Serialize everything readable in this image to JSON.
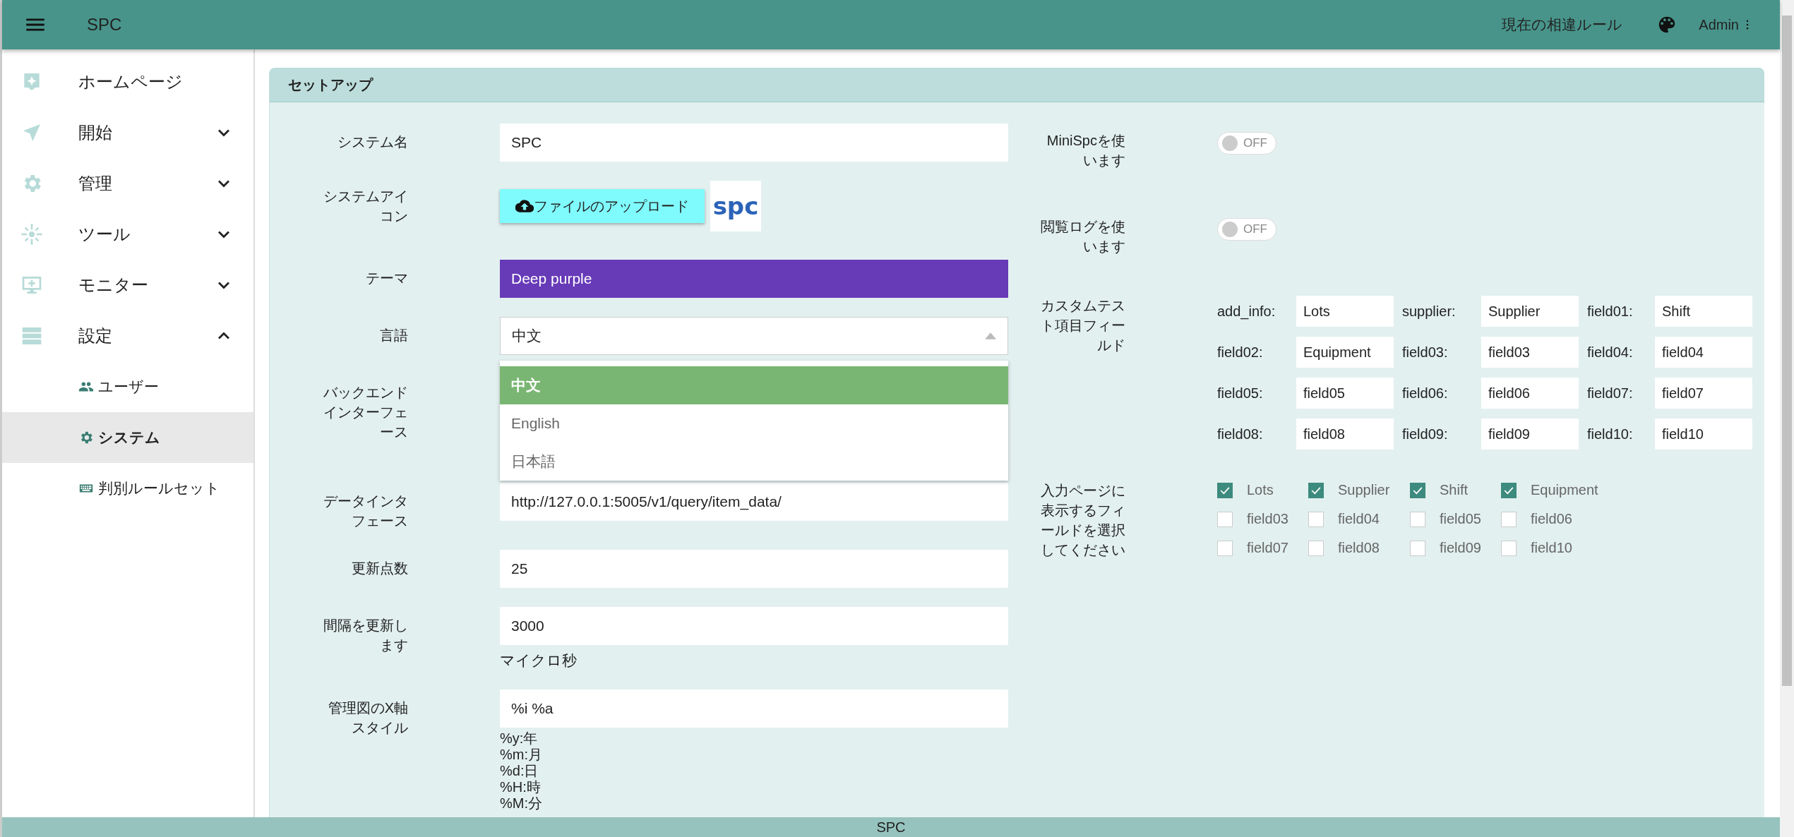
{
  "header": {
    "title": "SPC",
    "rule_link": "現在の相違ルール",
    "user": "Admin"
  },
  "sidebar": {
    "items": [
      {
        "label": "ホームページ"
      },
      {
        "label": "開始",
        "expanded": false
      },
      {
        "label": "管理",
        "expanded": false
      },
      {
        "label": "ツール",
        "expanded": false
      },
      {
        "label": "モニター",
        "expanded": false
      },
      {
        "label": "設定",
        "expanded": true,
        "children": [
          {
            "label": "ユーザー",
            "selected": false
          },
          {
            "label": "システム",
            "selected": true
          },
          {
            "label": "判別ルールセット",
            "selected": false
          }
        ]
      }
    ]
  },
  "setup": {
    "title": "セットアップ",
    "fields": [
      {
        "kind": "text",
        "label": "システム名",
        "value": "SPC"
      },
      {
        "kind": "upload",
        "label": "システムアイコン",
        "button": "ファイルのアップロード",
        "preview": "spc"
      },
      {
        "kind": "theme",
        "label": "テーマ",
        "value": "Deep purple",
        "color": "#673ab7"
      },
      {
        "kind": "select",
        "label": "言語",
        "value": "中文",
        "expanded": true,
        "options": [
          {
            "label": "中文",
            "selected": true
          },
          {
            "label": "English",
            "selected": false
          },
          {
            "label": "日本語",
            "selected": false
          }
        ]
      },
      {
        "kind": "covered",
        "label": "バックエンドインターフェース"
      },
      {
        "kind": "text",
        "label": "データインタフェース",
        "value": "http://127.0.0.1:5005/v1/query/item_data/"
      },
      {
        "kind": "text",
        "label": "更新点数",
        "value": "25"
      },
      {
        "kind": "text",
        "label": "間隔を更新します",
        "value": "3000",
        "unit": "マイクロ秒"
      },
      {
        "kind": "text",
        "label": "管理図のX軸スタイル",
        "value": "%i %a",
        "hints": [
          "%y:年",
          "%m:月",
          "%d:日",
          "%H:時",
          "%M:分"
        ]
      }
    ],
    "toggles": [
      {
        "label": "MiniSpcを使います",
        "on": false,
        "state_text": "OFF"
      },
      {
        "label": "閲覧ログを使います",
        "on": false,
        "state_text": "OFF"
      }
    ],
    "custom_fields": {
      "label": "カスタムテスト項目フィールド",
      "items": [
        {
          "key": "add_info:",
          "value": "Lots"
        },
        {
          "key": "supplier:",
          "value": "Supplier"
        },
        {
          "key": "field01:",
          "value": "Shift"
        },
        {
          "key": "field02:",
          "value": "Equipment"
        },
        {
          "key": "field03:",
          "value": "field03"
        },
        {
          "key": "field04:",
          "value": "field04"
        },
        {
          "key": "field05:",
          "value": "field05"
        },
        {
          "key": "field06:",
          "value": "field06"
        },
        {
          "key": "field07:",
          "value": "field07"
        },
        {
          "key": "field08:",
          "value": "field08"
        },
        {
          "key": "field09:",
          "value": "field09"
        },
        {
          "key": "field10:",
          "value": "field10"
        }
      ]
    },
    "display_fields": {
      "label": "入力ページに表示するフィールドを選択してください",
      "options": [
        {
          "label": "Lots",
          "checked": true
        },
        {
          "label": "Supplier",
          "checked": true
        },
        {
          "label": "Shift",
          "checked": true
        },
        {
          "label": "Equipment",
          "checked": true
        },
        {
          "label": "field03",
          "checked": false
        },
        {
          "label": "field04",
          "checked": false
        },
        {
          "label": "field05",
          "checked": false
        },
        {
          "label": "field06",
          "checked": false
        },
        {
          "label": "field07",
          "checked": false
        },
        {
          "label": "field08",
          "checked": false
        },
        {
          "label": "field09",
          "checked": false
        },
        {
          "label": "field10",
          "checked": false
        }
      ]
    }
  },
  "footer": {
    "text": "SPC"
  }
}
